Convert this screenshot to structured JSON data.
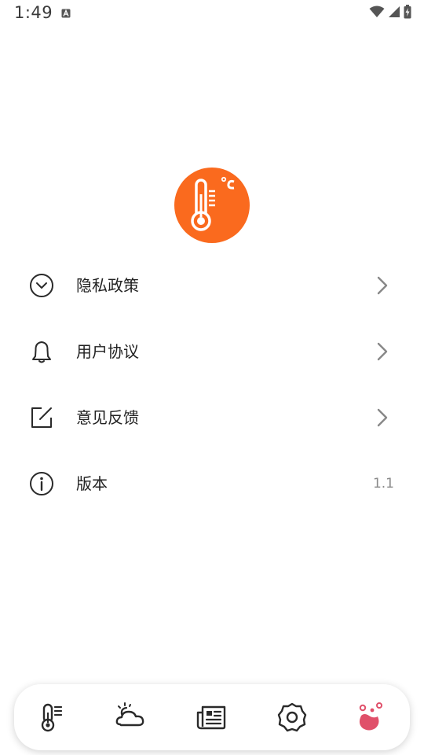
{
  "status_bar": {
    "time": "1:49",
    "notification_icon": "a-icon",
    "wifi_icon": "wifi-icon",
    "signal_icon": "signal-icon",
    "battery_icon": "battery-icon"
  },
  "app": {
    "logo_icon": "thermometer-celsius-icon",
    "logo_color": "#fa6a1e"
  },
  "menu": {
    "items": [
      {
        "label": "隐私政策",
        "icon": "chevron-down-circle-icon",
        "has_arrow": true
      },
      {
        "label": "用户协议",
        "icon": "bell-icon",
        "has_arrow": true
      },
      {
        "label": "意见反馈",
        "icon": "edit-icon",
        "has_arrow": true
      },
      {
        "label": "版本",
        "icon": "info-icon",
        "value": "1.1"
      }
    ]
  },
  "tabbar": {
    "tabs": [
      {
        "icon": "thermometer-icon",
        "active": false
      },
      {
        "icon": "weather-icon",
        "active": false
      },
      {
        "icon": "news-icon",
        "active": false
      },
      {
        "icon": "settings-gear-icon",
        "active": false
      },
      {
        "icon": "bubbles-icon",
        "active": true
      }
    ],
    "active_color": "#e0506a"
  }
}
